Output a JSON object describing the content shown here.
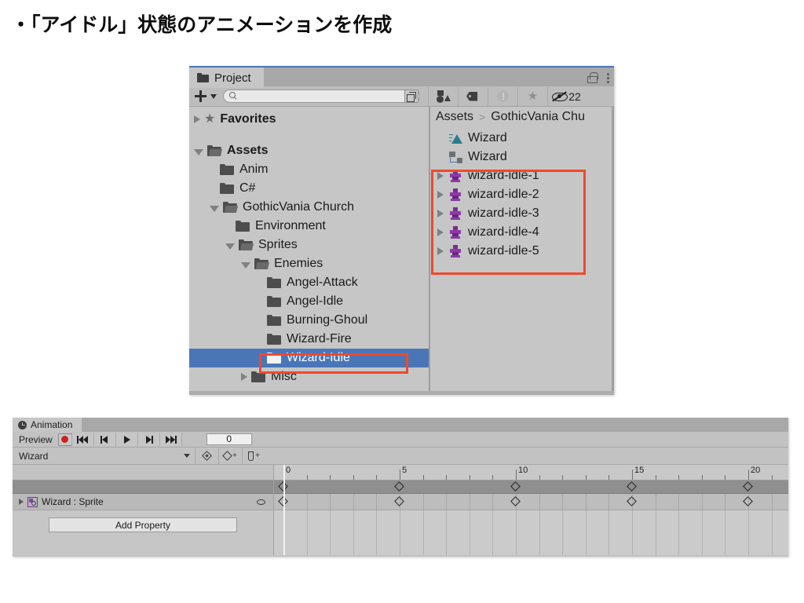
{
  "slide": {
    "bullet_title": "・「アイドル」状態のアニメーションを作成"
  },
  "project_window": {
    "tab_label": "Project",
    "tab_icon": "folder-icon",
    "lock_icon": "lock-open-icon",
    "menu_icon": "kebab-menu-icon",
    "toolbar": {
      "add_label": "+",
      "search_value": "",
      "search_placeholder": "",
      "filter_type_icon": "shapes-filter-icon",
      "filter_label_icon": "tag-icon",
      "warning_icon": "warning-circle-icon",
      "favorite_icon": "star-icon",
      "hidden_icon": "eye-slash-icon",
      "hidden_count": "22"
    },
    "tree": [
      {
        "label": "Favorites",
        "indent": 0,
        "arrow": "collapsed",
        "icon": "star-icon",
        "bold": true,
        "selected": false,
        "gap_after": true
      },
      {
        "label": "Assets",
        "indent": 0,
        "arrow": "expanded",
        "icon": "folder-open-icon",
        "bold": true,
        "selected": false
      },
      {
        "label": "Anim",
        "indent": 1,
        "arrow": "none",
        "icon": "folder-icon",
        "bold": false,
        "selected": false
      },
      {
        "label": "C#",
        "indent": 1,
        "arrow": "none",
        "icon": "folder-icon",
        "bold": false,
        "selected": false
      },
      {
        "label": "GothicVania Church",
        "indent": 1,
        "arrow": "expanded",
        "icon": "folder-open-icon",
        "bold": false,
        "selected": false
      },
      {
        "label": "Environment",
        "indent": 2,
        "arrow": "none",
        "icon": "folder-icon",
        "bold": false,
        "selected": false
      },
      {
        "label": "Sprites",
        "indent": 2,
        "arrow": "expanded",
        "icon": "folder-open-icon",
        "bold": false,
        "selected": false
      },
      {
        "label": "Enemies",
        "indent": 3,
        "arrow": "expanded",
        "icon": "folder-open-icon",
        "bold": false,
        "selected": false
      },
      {
        "label": "Angel-Attack",
        "indent": 4,
        "arrow": "none",
        "icon": "folder-icon",
        "bold": false,
        "selected": false
      },
      {
        "label": "Angel-Idle",
        "indent": 4,
        "arrow": "none",
        "icon": "folder-icon",
        "bold": false,
        "selected": false
      },
      {
        "label": "Burning-Ghoul",
        "indent": 4,
        "arrow": "none",
        "icon": "folder-icon",
        "bold": false,
        "selected": false
      },
      {
        "label": "Wizard-Fire",
        "indent": 4,
        "arrow": "none",
        "icon": "folder-icon",
        "bold": false,
        "selected": false
      },
      {
        "label": "Wizard-Idle",
        "indent": 4,
        "arrow": "none",
        "icon": "folder-white-icon",
        "bold": false,
        "selected": true
      },
      {
        "label": "Misc",
        "indent": 3,
        "arrow": "collapsed",
        "icon": "folder-icon",
        "bold": false,
        "selected": false
      }
    ],
    "breadcrumb": {
      "root": "Assets",
      "separator": ">",
      "current": "GothicVania Chu"
    },
    "files": [
      {
        "label": "Wizard",
        "icon": "animation-clip-icon",
        "arrow": false
      },
      {
        "label": "Wizard",
        "icon": "animator-controller-icon",
        "arrow": false
      },
      {
        "label": "wizard-idle-1",
        "icon": "sprite-icon",
        "arrow": true
      },
      {
        "label": "wizard-idle-2",
        "icon": "sprite-icon",
        "arrow": true
      },
      {
        "label": "wizard-idle-3",
        "icon": "sprite-icon",
        "arrow": true
      },
      {
        "label": "wizard-idle-4",
        "icon": "sprite-icon",
        "arrow": true
      },
      {
        "label": "wizard-idle-5",
        "icon": "sprite-icon",
        "arrow": true
      }
    ],
    "annotation_color": "#f0492a",
    "selection_color": "#4a76b8"
  },
  "animation_window": {
    "tab_label": "Animation",
    "tab_icon": "clock-icon",
    "preview_label": "Preview",
    "record_icon": "record-icon",
    "playback": [
      {
        "name": "skip-to-start-icon"
      },
      {
        "name": "previous-keyframe-icon"
      },
      {
        "name": "play-icon"
      },
      {
        "name": "next-keyframe-icon"
      },
      {
        "name": "skip-to-end-icon"
      }
    ],
    "frame_value": "0",
    "clip_name": "Wizard",
    "keyframe_tools": [
      {
        "name": "filter-keyframes-icon"
      },
      {
        "name": "add-keyframe-icon"
      },
      {
        "name": "add-event-icon"
      }
    ],
    "property_row": {
      "label": "Wizard : Sprite",
      "icon": "sprite-renderer-icon",
      "curve_toggle_icon": "ellipse-icon"
    },
    "add_property_label": "Add Property",
    "timeline": {
      "tick_labels": [
        "0",
        "5",
        "10",
        "15",
        "20"
      ],
      "tick_frames": [
        0,
        5,
        10,
        15,
        20
      ],
      "minor_ticks_per_major": 5,
      "playhead_frame": 0,
      "keyframes": [
        0,
        5,
        10,
        15,
        20
      ],
      "frames_visible": 21
    }
  }
}
